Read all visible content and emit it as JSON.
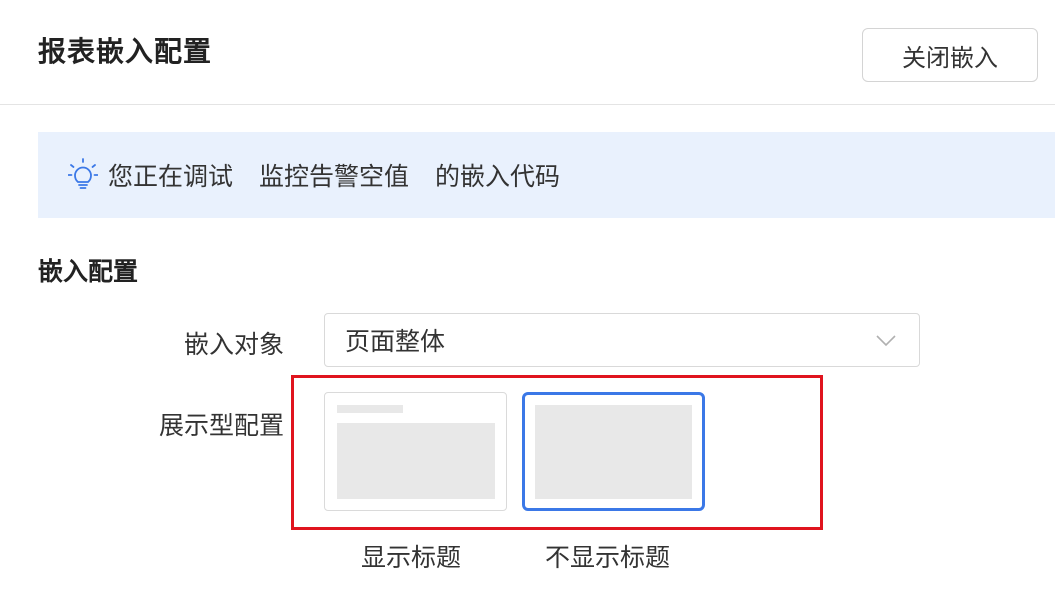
{
  "header": {
    "title": "报表嵌入配置",
    "close_label": "关闭嵌入"
  },
  "banner": {
    "icon": "lightbulb-icon",
    "prefix": "您正在调试",
    "report_name": "监控告警空值",
    "suffix": "的嵌入代码",
    "icon_color": "#3b78e7",
    "background": "#e9f1fd"
  },
  "section": {
    "title": "嵌入配置"
  },
  "embed_target": {
    "label": "嵌入对象",
    "value": "页面整体"
  },
  "display_config": {
    "label": "展示型配置",
    "options": [
      {
        "caption": "显示标题",
        "selected": false
      },
      {
        "caption": "不显示标题",
        "selected": true
      }
    ],
    "accent_color": "#3b78e7",
    "highlight_color": "#e0141e"
  }
}
